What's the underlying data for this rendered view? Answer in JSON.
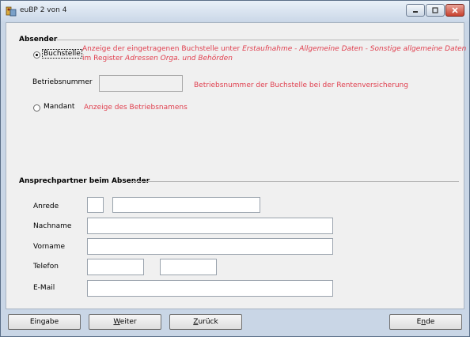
{
  "window": {
    "title": "euBP 2 von 4"
  },
  "absender": {
    "title": "Absender",
    "buchstelle_label": "Buchstelle",
    "buchstelle_hint_line1_a": "Anzeige der eingetragenen Buchstelle unter ",
    "buchstelle_hint_line1_b": "Erstaufnahme - Allgemeine Daten - Sonstige allgemeine Daten",
    "buchstelle_hint_line2_a": "im Register ",
    "buchstelle_hint_line2_b": "Adressen Orga. und Behörden",
    "betriebsnummer_label": "Betriebsnummer",
    "betriebsnummer_value": "",
    "betriebsnummer_hint": "Betriebsnummer der Buchstelle bei der Rentenversicherung",
    "mandant_label": "Mandant",
    "mandant_hint": "Anzeige des Betriebsnamens",
    "selected": "Buchstelle"
  },
  "ansprechpartner": {
    "title": "Ansprechpartner beim Absender",
    "anrede_label": "Anrede",
    "anrede_short_value": "",
    "anrede_value": "",
    "nachname_label": "Nachname",
    "nachname_value": "",
    "vorname_label": "Vorname",
    "vorname_value": "",
    "telefon_label": "Telefon",
    "telefon_prefix_value": "",
    "telefon_number_value": "",
    "email_label": "E-Mail",
    "email_value": ""
  },
  "buttons": {
    "eingabe": "Eingabe",
    "weiter_mnemonic": "W",
    "weiter_rest": "eiter",
    "zurueck_mnemonic": "Z",
    "zurueck_rest": "urück",
    "ende_first": "E",
    "ende_mnemonic": "n",
    "ende_rest": "de"
  }
}
